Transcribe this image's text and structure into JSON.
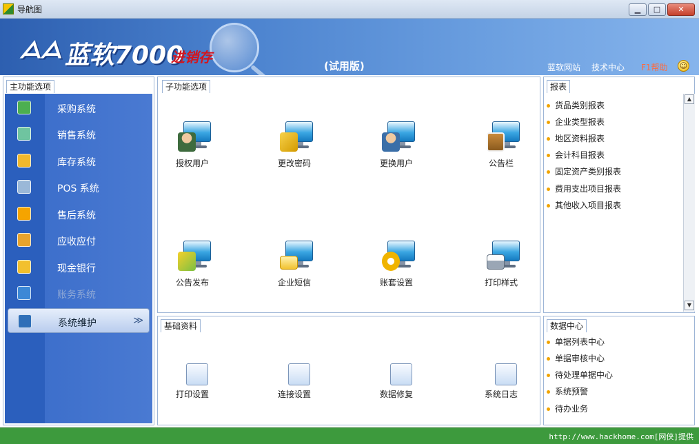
{
  "window": {
    "title": "导航图"
  },
  "banner": {
    "logo_mark": "ᗋᗋ",
    "product_name": "蓝软7000",
    "product_sub": "进销存",
    "edition": "(试用版)",
    "links": [
      "蓝软网站",
      "技术中心",
      "F1帮助"
    ]
  },
  "main_menu": {
    "title": "主功能选项",
    "items": [
      {
        "label": "采购系统",
        "icon": "grid-icon",
        "color": "#4caf50"
      },
      {
        "label": "销售系统",
        "icon": "calculator-icon",
        "color": "#6fc4a0"
      },
      {
        "label": "库存系统",
        "icon": "house-icon",
        "color": "#f1b82d"
      },
      {
        "label": "POS 系统",
        "icon": "pos-terminal-icon",
        "color": "#9ab8d8"
      },
      {
        "label": "售后系统",
        "icon": "star-icon",
        "color": "#f5a400"
      },
      {
        "label": "应收应付",
        "icon": "briefcase-icon",
        "color": "#e8a32c"
      },
      {
        "label": "现金银行",
        "icon": "envelope-icon",
        "color": "#f2c02e"
      },
      {
        "label": "账务系统",
        "icon": "book-icon",
        "color": "#3c88d6"
      },
      {
        "label": "系统维护",
        "icon": "monitor-icon",
        "color": "#2f6fb8"
      }
    ],
    "active_arrow": "≫"
  },
  "sub_menu": {
    "title": "子功能选项",
    "items": [
      {
        "label": "授权用户",
        "icon": "authorize-user-icon"
      },
      {
        "label": "更改密码",
        "icon": "change-password-icon"
      },
      {
        "label": "更换用户",
        "icon": "switch-user-icon"
      },
      {
        "label": "公告栏",
        "icon": "bulletin-board-icon"
      },
      {
        "label": "公告发布",
        "icon": "publish-notice-icon"
      },
      {
        "label": "企业短信",
        "icon": "sms-icon"
      },
      {
        "label": "账套设置",
        "icon": "account-settings-icon"
      },
      {
        "label": "打印样式",
        "icon": "print-style-icon"
      }
    ]
  },
  "basic_data": {
    "title": "基础资料",
    "items": [
      {
        "label": "打印设置",
        "icon": "printer-icon"
      },
      {
        "label": "连接设置",
        "icon": "connection-icon"
      },
      {
        "label": "数据修复",
        "icon": "data-repair-icon"
      },
      {
        "label": "系统日志",
        "icon": "system-log-icon"
      }
    ]
  },
  "reports": {
    "title": "报表",
    "items": [
      "货品类别报表",
      "企业类型报表",
      "地区资料报表",
      "会计科目报表",
      "固定资产类别报表",
      "费用支出项目报表",
      "其他收入项目报表"
    ]
  },
  "data_center": {
    "title": "数据中心",
    "items": [
      "单据列表中心",
      "单据审核中心",
      "待处理单据中心",
      "系统预警",
      "待办业务"
    ]
  },
  "status": {
    "watermark": "http://www.hackhome.com[网侠]提供"
  }
}
